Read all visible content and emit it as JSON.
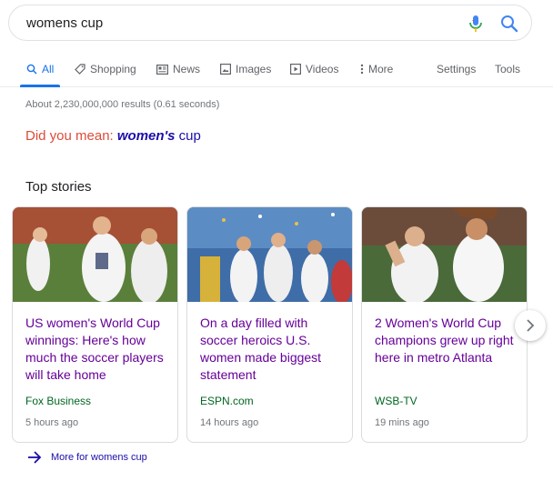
{
  "search": {
    "query": "womens cup"
  },
  "tabs": [
    {
      "label": "All",
      "active": true,
      "icon": "search-icon"
    },
    {
      "label": "Shopping",
      "icon": "tag-icon"
    },
    {
      "label": "News",
      "icon": "newspaper-icon"
    },
    {
      "label": "Images",
      "icon": "image-icon"
    },
    {
      "label": "Videos",
      "icon": "play-icon"
    },
    {
      "label": "More",
      "icon": "more-vert-icon"
    }
  ],
  "tools": {
    "settings": "Settings",
    "tools": "Tools"
  },
  "results_stats": "About 2,230,000,000 results (0.61 seconds)",
  "did_you_mean": {
    "label": "Did you mean:",
    "corrected": "women's",
    "rest": "cup"
  },
  "top_stories": {
    "title": "Top stories",
    "cards": [
      {
        "headline": "US women's World Cup winnings: Here's how much the soccer players will take home",
        "source": "Fox Business",
        "time": "5 hours ago"
      },
      {
        "headline": "On a day filled with soccer heroics U.S. women made biggest statement",
        "source": "ESPN.com",
        "time": "14 hours ago"
      },
      {
        "headline": "2 Women's World Cup champions grew up right here in metro Atlanta",
        "source": "WSB-TV",
        "time": "19 mins ago"
      }
    ],
    "more_link": "More for womens cup"
  },
  "colors": {
    "link_blue": "#1a0dab",
    "visited_purple": "#660099",
    "source_green": "#006621",
    "accent_blue": "#1a73e8",
    "did_you_mean_red": "#dd4b39"
  }
}
